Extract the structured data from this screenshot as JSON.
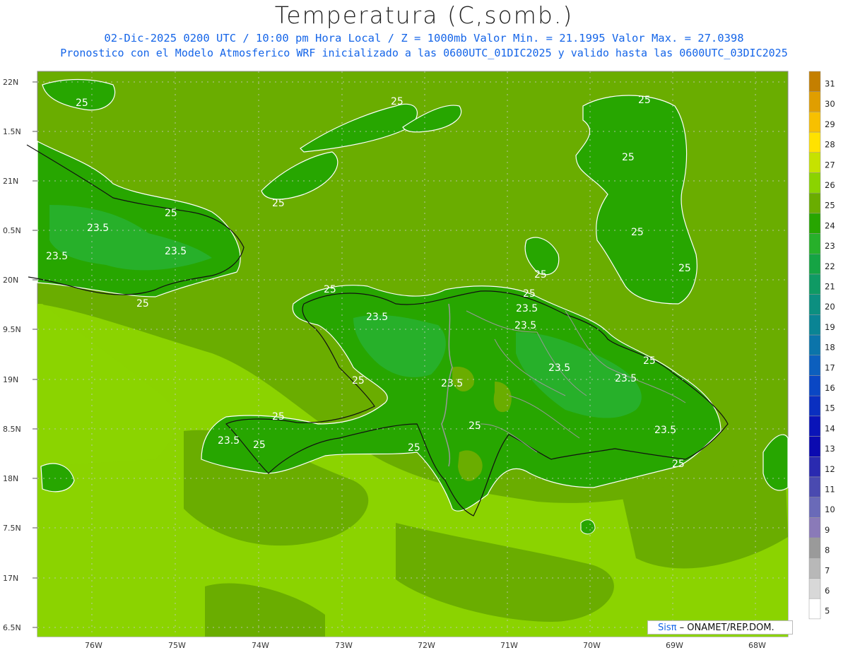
{
  "header": {
    "title": "Temperatura (C,somb.)",
    "line1": "02-Dic-2025 0200 UTC / 10:00 pm Hora Local / Z = 1000mb  Valor Min. = 21.1995  Valor Max. = 27.0398",
    "line2": "Pronostico con el Modelo Atmosferico WRF inicializado a las 0600UTC_01DIC2025 y valido hasta las  0600UTC_03DIC2025"
  },
  "map": {
    "lat_labels": [
      "22N",
      "1.5N",
      "21N",
      "0.5N",
      "20N",
      "9.5N",
      "19N",
      "8.5N",
      "18N",
      "7.5N",
      "17N",
      "6.5N"
    ],
    "lon_labels": [
      "76W",
      "75W",
      "74W",
      "73W",
      "72W",
      "71W",
      "70W",
      "69W",
      "68W"
    ],
    "contour_labels": [
      "25",
      "25",
      "25",
      "25",
      "25",
      "25",
      "25",
      "25",
      "25",
      "25",
      "23.5",
      "23.5",
      "23.5",
      "25",
      "23.5",
      "23.5",
      "25",
      "25",
      "23.5",
      "25",
      "23.5",
      "23.5",
      "25",
      "23.5",
      "25",
      "25",
      "25",
      "23.5",
      "23.5",
      "25"
    ]
  },
  "colorbar": {
    "labels": [
      "31",
      "30",
      "29",
      "28",
      "27",
      "26",
      "25",
      "24",
      "23",
      "22",
      "21",
      "20",
      "19",
      "18",
      "17",
      "16",
      "15",
      "14",
      "13",
      "12",
      "11",
      "10",
      "9",
      "8",
      "7",
      "6",
      "5"
    ],
    "colors": [
      "#c47f00",
      "#e09e00",
      "#f7c000",
      "#ffe200",
      "#c6e200",
      "#8bd300",
      "#6aad00",
      "#27a600",
      "#27b02a",
      "#15a444",
      "#0f9a64",
      "#0c8f80",
      "#0a8494",
      "#0b74aa",
      "#0c5fbe",
      "#0a47c4",
      "#0a2fc0",
      "#0a14b8",
      "#0b0ab0",
      "#2a2ab0",
      "#4a4ab0",
      "#6a6ab8",
      "#8a7ab8",
      "#9a9a9a",
      "#b8b8b8",
      "#d8d8d8",
      "#ffffff"
    ]
  },
  "credit": {
    "logo": "Sisπ",
    "text": "– ONAMET/REP.DOM."
  }
}
